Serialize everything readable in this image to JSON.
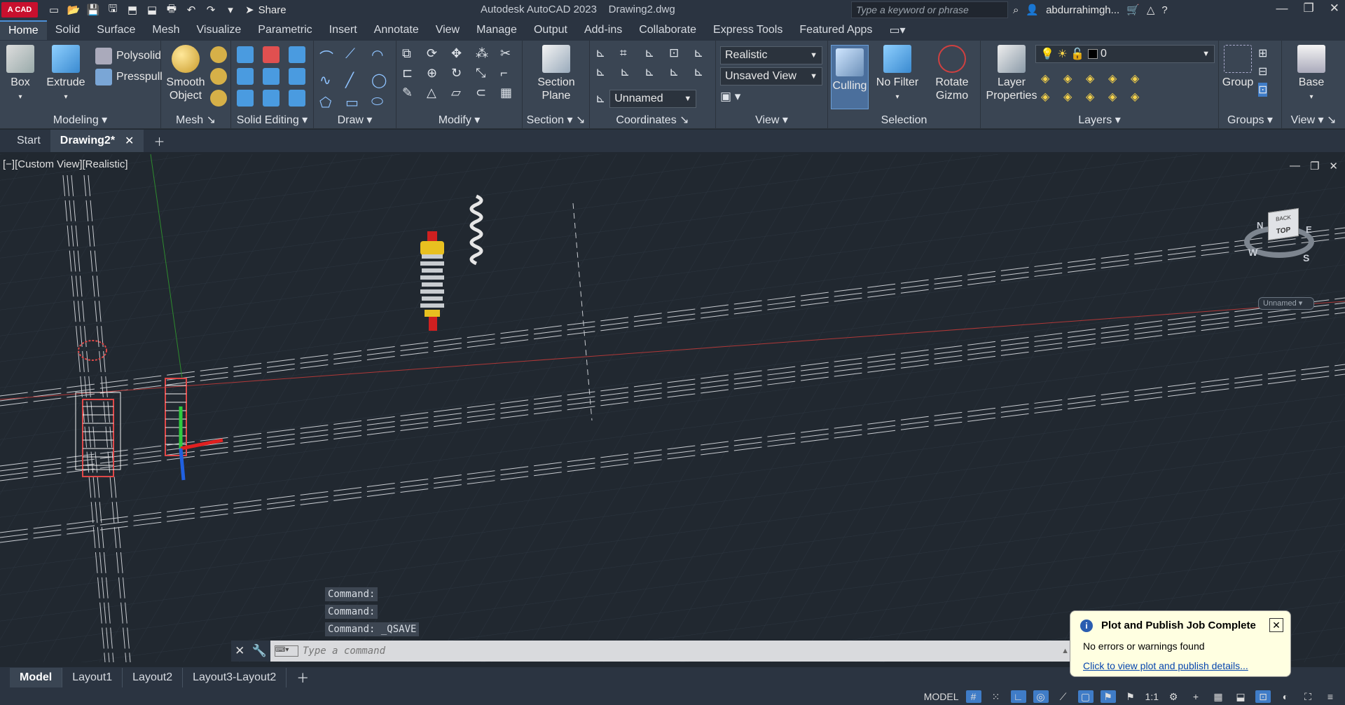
{
  "app": {
    "logo_text": "A CAD",
    "title": "Autodesk AutoCAD 2023",
    "document": "Drawing2.dwg",
    "share_label": "Share",
    "search_placeholder": "Type a keyword or phrase",
    "user": "abdurrahimgh..."
  },
  "ribbon_tabs": [
    "Home",
    "Solid",
    "Surface",
    "Mesh",
    "Visualize",
    "Parametric",
    "Insert",
    "Annotate",
    "View",
    "Manage",
    "Output",
    "Add-ins",
    "Collaborate",
    "Express Tools",
    "Featured Apps"
  ],
  "ribbon": {
    "box": "Box",
    "extrude": "Extrude",
    "polysolid": "Polysolid",
    "presspull": "Presspull",
    "smooth_object_1": "Smooth",
    "smooth_object_2": "Object",
    "section_plane_1": "Section",
    "section_plane_2": "Plane",
    "visual_style": "Realistic",
    "saved_view": "Unsaved View",
    "ucs_named": "Unnamed",
    "culling": "Culling",
    "no_filter": "No Filter",
    "rotate_gizmo_1": "Rotate",
    "rotate_gizmo_2": "Gizmo",
    "layer_properties_1": "Layer",
    "layer_properties_2": "Properties",
    "layer_current": "0",
    "group": "Group",
    "base": "Base",
    "panels": {
      "modeling": "Modeling",
      "mesh": "Mesh",
      "solid_editing": "Solid Editing",
      "draw": "Draw",
      "modify": "Modify",
      "section": "Section",
      "coordinates": "Coordinates",
      "view": "View",
      "selection": "Selection",
      "layers": "Layers",
      "groups": "Groups",
      "view2": "View"
    }
  },
  "doc_tabs": [
    "Start",
    "Drawing2*"
  ],
  "viewport": {
    "label": "[−][Custom View][Realistic]",
    "viewcube_top": "TOP",
    "viewcube_back": "BACK",
    "compass": {
      "n": "N",
      "e": "E",
      "s": "S",
      "w": "W"
    },
    "ucs_name": "Unnamed"
  },
  "command": {
    "history": [
      "Command:",
      "Command:",
      "Command:  _QSAVE"
    ],
    "placeholder": "Type a command"
  },
  "layout_tabs": [
    "Model",
    "Layout1",
    "Layout2",
    "Layout3-Layout2"
  ],
  "status": {
    "model_label": "MODEL",
    "scale": "1:1"
  },
  "notification": {
    "title": "Plot and Publish Job Complete",
    "message": "No errors or warnings found",
    "link": "Click to view plot and publish details..."
  },
  "colors": {
    "accent": "#3f7cc7",
    "viewport": "#212830",
    "ribbon": "#3a4553",
    "logo": "#c8102e"
  }
}
